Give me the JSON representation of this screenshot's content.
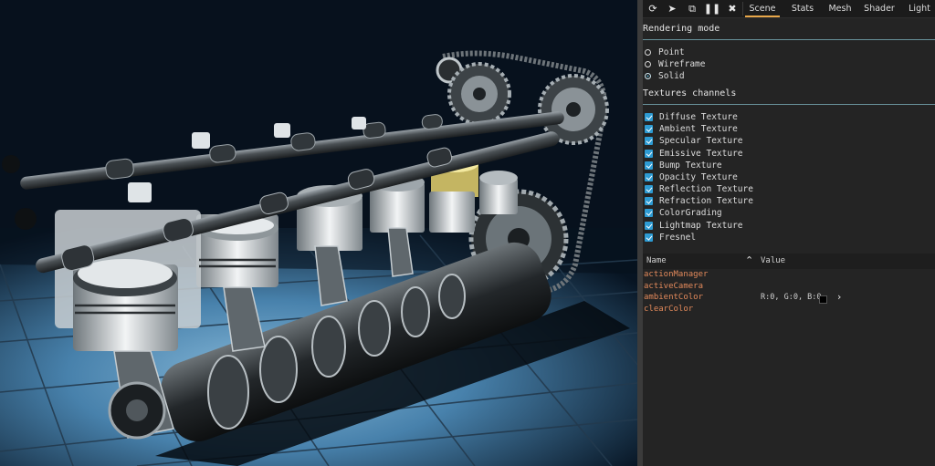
{
  "toolbar": {
    "icons": [
      "refresh-icon",
      "pointer-icon",
      "popout-icon",
      "pause-icon",
      "close-icon"
    ],
    "tabs": [
      {
        "label": "Scene",
        "active": true
      },
      {
        "label": "Stats",
        "active": false
      },
      {
        "label": "Mesh",
        "active": false
      },
      {
        "label": "Shader",
        "active": false
      },
      {
        "label": "Light",
        "active": false
      }
    ],
    "accent": "#e8a74a"
  },
  "rendering_mode": {
    "title": "Rendering mode",
    "options": [
      {
        "label": "Point",
        "checked": false
      },
      {
        "label": "Wireframe",
        "checked": false
      },
      {
        "label": "Solid",
        "checked": true
      }
    ]
  },
  "textures_channels": {
    "title": "Textures channels",
    "items": [
      {
        "label": "Diffuse Texture",
        "checked": true
      },
      {
        "label": "Ambient Texture",
        "checked": true
      },
      {
        "label": "Specular Texture",
        "checked": true
      },
      {
        "label": "Emissive Texture",
        "checked": true
      },
      {
        "label": "Bump Texture",
        "checked": true
      },
      {
        "label": "Opacity Texture",
        "checked": true
      },
      {
        "label": "Reflection Texture",
        "checked": true
      },
      {
        "label": "Refraction Texture",
        "checked": true
      },
      {
        "label": "ColorGrading",
        "checked": true
      },
      {
        "label": "Lightmap Texture",
        "checked": true
      },
      {
        "label": "Fresnel",
        "checked": true
      }
    ]
  },
  "properties": {
    "header_name": "Name",
    "header_value": "Value",
    "rows": [
      {
        "name": "actionManager",
        "value": ""
      },
      {
        "name": "activeCamera",
        "value": ""
      },
      {
        "name": "ambientColor",
        "value": "R:0, G:0, B:0"
      },
      {
        "name": "clearColor",
        "value": ""
      }
    ]
  },
  "colors": {
    "property_name": "#e2895b",
    "checkbox": "#2d9bd3",
    "section_line": "#7fb6c2"
  }
}
